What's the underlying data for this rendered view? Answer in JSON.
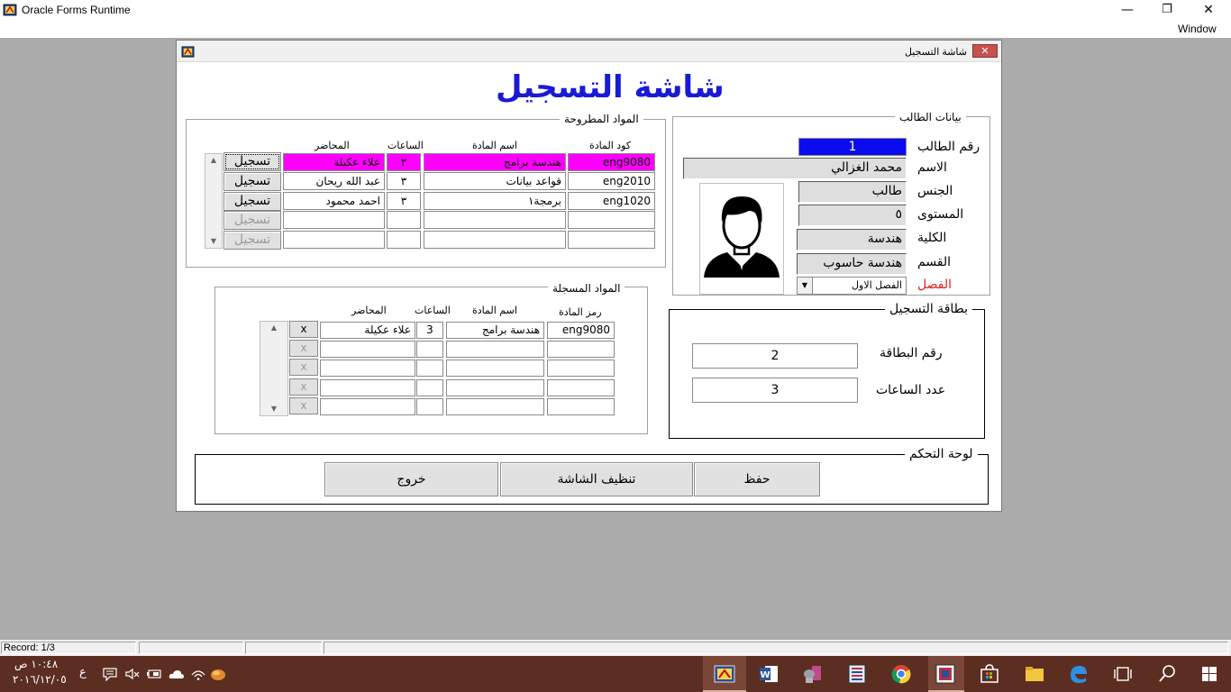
{
  "app": {
    "title": "Oracle Forms Runtime",
    "menu_window": "Window",
    "minimize": "—",
    "restore": "❐",
    "close": "✕"
  },
  "form": {
    "window_title": "شاشة التسجيل",
    "close_glyph": "✕",
    "heading": "شاشة التسجيل"
  },
  "student": {
    "legend": "بيانات الطالب",
    "labels": {
      "id": "رقم الطالب",
      "name": "الاسم",
      "gender": "الجنس",
      "level": "المستوى",
      "college": "الكلية",
      "department": "القسم",
      "semester": "الفصل"
    },
    "values": {
      "id": "1",
      "name": "محمد الغزالي",
      "gender": "طالب",
      "level": "٥",
      "college": "هندسة",
      "department": "هندسة حاسوب",
      "semester": "الفصل الاول"
    }
  },
  "offered": {
    "legend": "المواد المطروحة",
    "headers": {
      "code": "كود المادة",
      "name": "اسم المادة",
      "hours": "الساعات",
      "lecturer": "المحاضر"
    },
    "register_label": "تسجيل",
    "rows": [
      {
        "code": "eng9080",
        "name": "هندسة برامج",
        "hours": "٣",
        "lecturer": "علاء عكيلة"
      },
      {
        "code": "eng2010",
        "name": "قواعد بيانات",
        "hours": "٣",
        "lecturer": "عبد الله ريحان"
      },
      {
        "code": "eng1020",
        "name": "برمجة١",
        "hours": "٣",
        "lecturer": "احمد محمود"
      },
      {
        "code": "",
        "name": "",
        "hours": "",
        "lecturer": ""
      },
      {
        "code": "",
        "name": "",
        "hours": "",
        "lecturer": ""
      }
    ]
  },
  "registered": {
    "legend": "المواد المسجلة",
    "headers": {
      "code": "رمز المادة",
      "name": "اسم المادة",
      "hours": "الساعات",
      "lecturer": "المحاضر"
    },
    "delete_label": "x",
    "rows": [
      {
        "code": "eng9080",
        "name": "هندسة برامج",
        "hours": "3",
        "lecturer": "علاء عكيلة"
      },
      {
        "code": "",
        "name": "",
        "hours": "",
        "lecturer": ""
      },
      {
        "code": "",
        "name": "",
        "hours": "",
        "lecturer": ""
      },
      {
        "code": "",
        "name": "",
        "hours": "",
        "lecturer": ""
      },
      {
        "code": "",
        "name": "",
        "hours": "",
        "lecturer": ""
      }
    ]
  },
  "card": {
    "legend": "بطاقة التسجيل",
    "card_no_label": "رقم البطاقة",
    "card_no": "2",
    "hours_label": "عدد الساعات",
    "hours": "3"
  },
  "control": {
    "legend": "لوحة التحكم",
    "save": "حفظ",
    "clear": "تنظيف الشاشة",
    "exit": "خروج"
  },
  "status": {
    "record": "Record: 1/3"
  },
  "tray": {
    "time": "١٠:٤٨ ص",
    "date": "٢٠١٦/١٢/٠٥",
    "lang": "ع"
  },
  "colors": {
    "heading": "#1a1ad6",
    "selected_row": "#ff00ff",
    "current_field": "#0b0bf0",
    "taskbar": "#5c2e22",
    "semester_label": "#e02020"
  }
}
